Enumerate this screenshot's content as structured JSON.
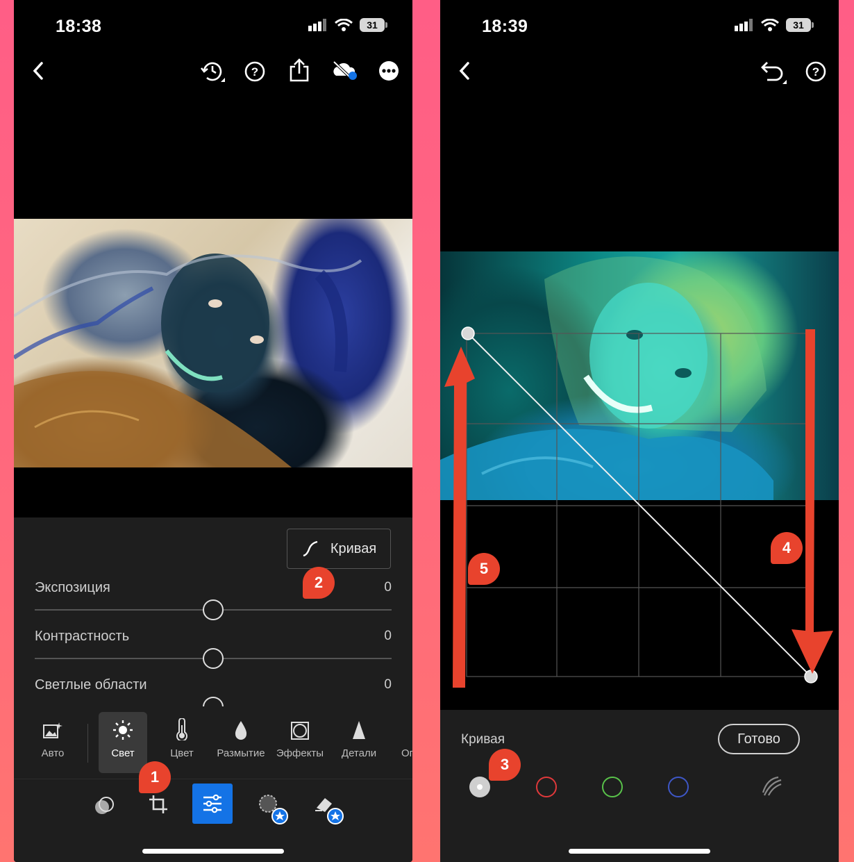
{
  "left": {
    "status": {
      "time": "18:38",
      "battery": "31"
    },
    "toolbar_icons": [
      "back-icon",
      "history-icon",
      "help-icon",
      "share-icon",
      "cloud-sync-icon",
      "more-icon"
    ],
    "curve_button": {
      "label": "Кривая"
    },
    "sliders": [
      {
        "label": "Экспозиция",
        "value": "0",
        "position": 0.5
      },
      {
        "label": "Контрастность",
        "value": "0",
        "position": 0.5
      },
      {
        "label": "Светлые области",
        "value": "0",
        "position": 0.5
      }
    ],
    "tools": [
      {
        "label": "Авто",
        "icon": "auto-photo-icon"
      },
      {
        "label": "Свет",
        "icon": "sun-icon",
        "selected": true
      },
      {
        "label": "Цвет",
        "icon": "thermometer-icon"
      },
      {
        "label": "Размытие",
        "icon": "drop-icon"
      },
      {
        "label": "Эффекты",
        "icon": "vignette-icon"
      },
      {
        "label": "Детали",
        "icon": "triangle-icon"
      },
      {
        "label": "Оп",
        "icon": "optics-icon"
      }
    ],
    "bottom_tabs": [
      "presets-icon",
      "crop-icon",
      "edit-sliders-icon",
      "masking-icon",
      "healing-icon"
    ],
    "callouts": [
      "1",
      "2"
    ],
    "accent": "#1473e6"
  },
  "right": {
    "status": {
      "time": "18:39",
      "battery": "31"
    },
    "toolbar_icons": [
      "back-icon",
      "undo-icon",
      "help-icon"
    ],
    "curve_label": "Кривая",
    "done_button": "Готово",
    "channels": [
      {
        "name": "rgb",
        "color": "#cfcfcf"
      },
      {
        "name": "red",
        "color": "#e0393b"
      },
      {
        "name": "green",
        "color": "#59c24a"
      },
      {
        "name": "blue",
        "color": "#3e57c7"
      }
    ],
    "curve_points": [
      {
        "in": 0,
        "out": 1
      },
      {
        "in": 1,
        "out": 0
      }
    ],
    "callouts": [
      "3",
      "4",
      "5"
    ],
    "arrow_color": "#e8432d"
  }
}
